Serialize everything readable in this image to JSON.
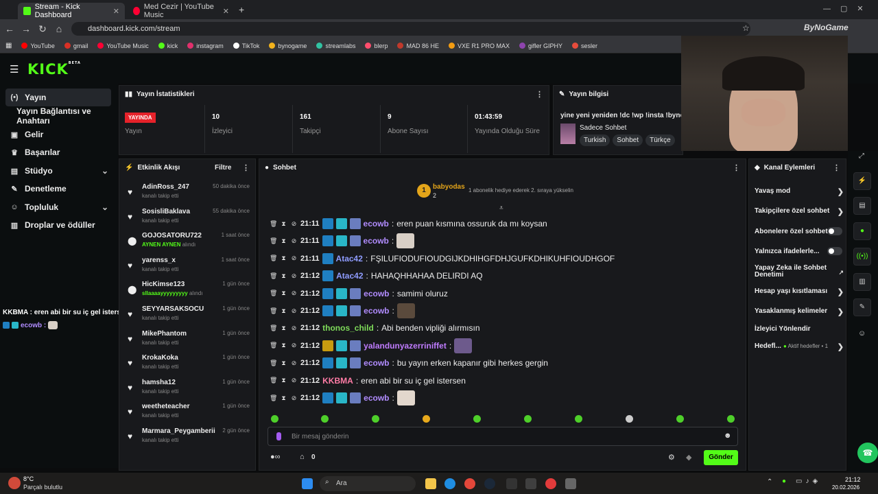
{
  "browser": {
    "tabs": [
      {
        "label": "Stream - Kick Dashboard",
        "color": "#53fc18"
      },
      {
        "label": "Med Cezir | YouTube Music",
        "color": "#ff0033"
      }
    ],
    "new_tab": "+",
    "url": "dashboard.kick.com/stream",
    "bookmarks": [
      {
        "label": "YouTube",
        "color": "#ff0000"
      },
      {
        "label": "gmail",
        "color": "#d93025"
      },
      {
        "label": "YouTube Music",
        "color": "#ff0033"
      },
      {
        "label": "kick",
        "color": "#53fc18"
      },
      {
        "label": "instagram",
        "color": "#e1306c"
      },
      {
        "label": "TikTok",
        "color": "#ffffff"
      },
      {
        "label": "bynogame",
        "color": "#f2b21c"
      },
      {
        "label": "streamlabs",
        "color": "#31c3a2"
      },
      {
        "label": "blerp",
        "color": "#ff4d6d"
      },
      {
        "label": "MAD 86 HE",
        "color": "#c0392b"
      },
      {
        "label": "VXE R1 PRO MAX",
        "color": "#f39c12"
      },
      {
        "label": "gifler GIPHY",
        "color": "#8e44ad"
      },
      {
        "label": "sesler",
        "color": "#e74c3c"
      }
    ]
  },
  "kick": {
    "logo": "KICK",
    "beta": "BETA"
  },
  "sidebar": {
    "items": [
      {
        "label": "Yayın",
        "icon": "broadcast-icon"
      },
      {
        "label": "Yayın Bağlantısı ve Anahtarı",
        "icon": ""
      },
      {
        "label": "Gelir",
        "icon": "money-icon"
      },
      {
        "label": "Başarılar",
        "icon": "trophy-icon"
      },
      {
        "label": "Stüdyo",
        "icon": "studio-icon"
      },
      {
        "label": "Denetleme",
        "icon": "wrench-icon"
      },
      {
        "label": "Topluluk",
        "icon": "people-icon"
      },
      {
        "label": "Droplar ve ödüller",
        "icon": "gift-icon"
      }
    ]
  },
  "stats": {
    "title": "Yayın İstatistikleri",
    "live_badge": "YAYINDA",
    "items": [
      {
        "value": "",
        "label": "Yayın"
      },
      {
        "value": "10",
        "label": "İzleyici"
      },
      {
        "value": "161",
        "label": "Takipçi"
      },
      {
        "value": "9",
        "label": "Abone Sayısı"
      },
      {
        "value": "01:43:59",
        "label": "Yayında Olduğu Süre"
      }
    ]
  },
  "stream_info": {
    "title": "Yayın bilgisi",
    "stream_title": "yine yeni yeniden !dc !wp !insta !bynog",
    "category": "Sadece Sohbet",
    "tags": [
      "Turkish",
      "Sohbet",
      "Türkçe"
    ]
  },
  "activity": {
    "title": "Etkinlik Akışı",
    "filter": "Filtre",
    "items": [
      {
        "name": "AdinRoss_247",
        "sub": "kanalı takip etti",
        "time": "50 dakika önce",
        "type": "follow",
        "highlight": ""
      },
      {
        "name": "SosisliBaklava",
        "sub": "kanalı takip etti",
        "time": "55 dakika önce",
        "type": "follow",
        "highlight": ""
      },
      {
        "name": "GOJOSATORU722",
        "sub": "alındı",
        "time": "1 saat önce",
        "type": "reward",
        "highlight": "AYNEN AYNEN"
      },
      {
        "name": "yarenss_x",
        "sub": "kanalı takip etti",
        "time": "1 saat önce",
        "type": "follow",
        "highlight": ""
      },
      {
        "name": "HicKimse123",
        "sub": "alındı",
        "time": "1 gün önce",
        "type": "reward",
        "highlight": "sllaaaayyyyyyyyy"
      },
      {
        "name": "SEYYARSAKSOCU",
        "sub": "kanalı takip etti",
        "time": "1 gün önce",
        "type": "follow",
        "highlight": ""
      },
      {
        "name": "MikePhantom",
        "sub": "kanalı takip etti",
        "time": "1 gün önce",
        "type": "follow",
        "highlight": ""
      },
      {
        "name": "KrokaKoka",
        "sub": "kanalı takip etti",
        "time": "1 gün önce",
        "type": "follow",
        "highlight": ""
      },
      {
        "name": "hamsha12",
        "sub": "kanalı takip etti",
        "time": "1 gün önce",
        "type": "follow",
        "highlight": ""
      },
      {
        "name": "weetheteacher",
        "sub": "kanalı takip etti",
        "time": "1 gün önce",
        "type": "follow",
        "highlight": ""
      },
      {
        "name": "Marmara_Peygamberii",
        "sub": "kanalı takip etti",
        "time": "2 gün önce",
        "type": "follow",
        "highlight": ""
      }
    ]
  },
  "chat": {
    "title": "Sohbet",
    "pinned": {
      "rank": "1",
      "user": "babyodas",
      "count": "2",
      "note": "1 abonelik hediye ederek 2. sıraya yükselin"
    },
    "messages": [
      {
        "time": "21:11",
        "badges": [
          "mod",
          "og",
          "av"
        ],
        "user": "ecowb",
        "color": "#b18cff",
        "text": "eren puan kısmına ossuruk da mı koysan",
        "emote": ""
      },
      {
        "time": "21:11",
        "badges": [
          "mod",
          "og",
          "av"
        ],
        "user": "ecowb",
        "color": "#b18cff",
        "text": "",
        "emote": "#d8cfc6"
      },
      {
        "time": "21:11",
        "badges": [
          "mod"
        ],
        "user": "Atac42",
        "color": "#8f9cff",
        "text": "FŞILUFIODUFIOUDGIJKDHIHGFDHJGUFKDHIKUHFIOUDHGOF",
        "emote": ""
      },
      {
        "time": "21:12",
        "badges": [
          "mod"
        ],
        "user": "Atac42",
        "color": "#8f9cff",
        "text": "HAHAQHHAHAA DELIRDI AQ",
        "emote": ""
      },
      {
        "time": "21:12",
        "badges": [
          "mod",
          "og",
          "av"
        ],
        "user": "ecowb",
        "color": "#b18cff",
        "text": "samimi oluruz",
        "emote": ""
      },
      {
        "time": "21:12",
        "badges": [
          "mod",
          "og",
          "av"
        ],
        "user": "ecowb",
        "color": "#b18cff",
        "text": "",
        "emote": "#5a4a3c"
      },
      {
        "time": "21:12",
        "badges": [],
        "user": "thonos_child",
        "color": "#7fdc5a",
        "text": "Abi benden vipliği alırmısın",
        "emote": ""
      },
      {
        "time": "21:12",
        "badges": [
          "sub",
          "og",
          "av"
        ],
        "user": "yalandunyazerriniffet",
        "color": "#c07cff",
        "text": "",
        "emote": "#6d5a8c"
      },
      {
        "time": "21:12",
        "badges": [
          "mod",
          "og",
          "av"
        ],
        "user": "ecowb",
        "color": "#b18cff",
        "text": "bu yayın erken kapanır gibi herkes gergin",
        "emote": ""
      },
      {
        "time": "21:12",
        "badges": [],
        "user": "KKBMA",
        "color": "#ff7ca6",
        "text": "eren abi bir su iç gel istersen",
        "emote": ""
      },
      {
        "time": "21:12",
        "badges": [
          "mod",
          "og",
          "av"
        ],
        "user": "ecowb",
        "color": "#b18cff",
        "text": "",
        "emote": "#e2d7cd"
      }
    ],
    "input_placeholder": "Bir mesaj gönderin",
    "points": "0",
    "send": "Gönder"
  },
  "channel_actions": {
    "title": "Kanal Eylemleri",
    "items": [
      {
        "label": "Yavaş mod",
        "control": "arrow"
      },
      {
        "label": "Takipçilere özel sohbet",
        "control": "arrow"
      },
      {
        "label": "Abonelere özel sohbet",
        "control": "toggle"
      },
      {
        "label": "Yalnızca ifadelerle...",
        "control": "toggle"
      },
      {
        "label": "Yapay Zeka ile Sohbet Denetimi",
        "control": "external"
      },
      {
        "label": "Hesap yaşı kısıtlaması",
        "control": "arrow"
      },
      {
        "label": "Yasaklanmış kelimeler",
        "control": "arrow"
      },
      {
        "label": "İzleyici Yönlendir",
        "control": ""
      },
      {
        "label": "Hedefl...",
        "control": "arrow",
        "extra": "Aktif hedefler • 1"
      }
    ]
  },
  "overlay": {
    "line1": "KKBMA : eren abi bir su iç gel istersen",
    "line2_user": "ecowb :"
  },
  "webcam_watermark": "ByNoGame",
  "taskbar": {
    "weather_temp": "8°C",
    "weather_desc": "Parçalı bulutlu",
    "search": "Ara",
    "time": "21:12",
    "date": "20.02.2026"
  }
}
